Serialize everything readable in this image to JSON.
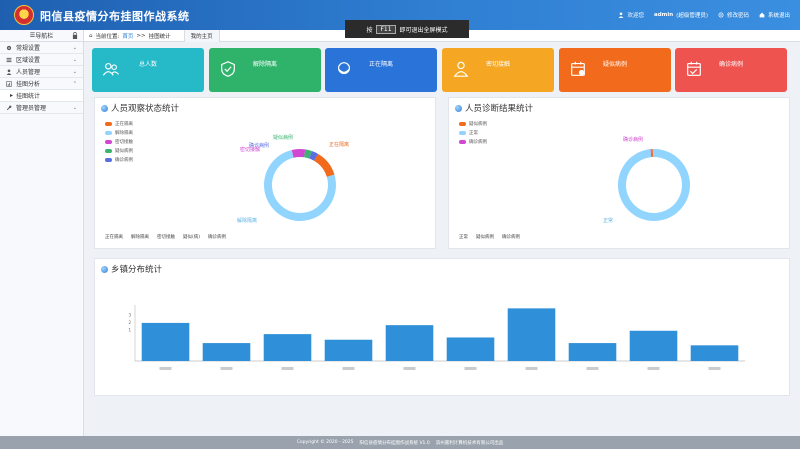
{
  "header": {
    "title": "阳信县疫情分布挂图作战系统",
    "welcome": "欢迎您",
    "user": "admin",
    "role": "(超级管理员)",
    "change_password": "修改密码",
    "logout": "系统退出"
  },
  "fullscreen_tip": {
    "prefix": "按",
    "key": "F11",
    "suffix": "即可退出全屏模式"
  },
  "sidebar": {
    "header": "导航栏",
    "items": [
      {
        "label": "常规设置",
        "icon": "gear-icon"
      },
      {
        "label": "区域设置",
        "icon": "list-icon"
      },
      {
        "label": "人员管理",
        "icon": "user-icon"
      },
      {
        "label": "挂图分析",
        "icon": "chart-icon"
      },
      {
        "label": "挂图统计",
        "icon": "sub-icon"
      },
      {
        "label": "管理员管理",
        "icon": "wrench-icon"
      }
    ]
  },
  "breadcrumb": {
    "prefix": "当前位置:",
    "home": "首页",
    "sep": ">>",
    "current": "挂图统计",
    "tab": "我的主页"
  },
  "cards": [
    {
      "label": "总人数",
      "value": "",
      "color": "#26b9c7",
      "icon": "people-icon"
    },
    {
      "label": "解除隔离",
      "value": "",
      "color": "#2fb36b",
      "icon": "shield-check-icon"
    },
    {
      "label": "正在隔离",
      "value": "",
      "color": "#2a73d8",
      "icon": "mask-icon"
    },
    {
      "label": "密切接触",
      "value": "",
      "color": "#f5a623",
      "icon": "person-icon"
    },
    {
      "label": "疑似病例",
      "value": "",
      "color": "#f26a1b",
      "icon": "calendar-icon"
    },
    {
      "label": "确诊病例",
      "value": "",
      "color": "#ef5350",
      "icon": "calendar-check-icon"
    }
  ],
  "observe_panel": {
    "title": "人员观察状态统计",
    "legend": [
      {
        "label": "正在隔离",
        "color": "#f26a1b"
      },
      {
        "label": "解除隔离",
        "color": "#91d5ff"
      },
      {
        "label": "密切接触",
        "color": "#d147d1"
      },
      {
        "label": "疑似病例",
        "color": "#3cb371"
      },
      {
        "label": "确诊病例",
        "color": "#5b6ee1"
      }
    ],
    "donut_labels": [
      "疑似病例",
      "确诊病例",
      "密切接触",
      "正在隔离",
      "解除隔离"
    ],
    "bottom": [
      "正在隔离",
      "解除隔离",
      "密切接触",
      "疑似(病)",
      "确诊病例"
    ]
  },
  "diagnose_panel": {
    "title": "人员诊断结果统计",
    "legend": [
      {
        "label": "疑似病例",
        "color": "#f26a1b"
      },
      {
        "label": "正常",
        "color": "#91d5ff"
      },
      {
        "label": "确诊病例",
        "color": "#d147d1"
      }
    ],
    "donut_labels": [
      "确诊病例",
      "正常"
    ],
    "bottom": [
      "正常",
      "疑似病例",
      "确诊病例"
    ]
  },
  "town_panel": {
    "title": "乡镇分布统计"
  },
  "chart_data": [
    {
      "type": "pie",
      "title": "人员观察状态统计",
      "labels": [
        "正在隔离",
        "解除隔离",
        "密切接触",
        "疑似病例",
        "确诊病例"
      ],
      "values": [
        12,
        76,
        6,
        3,
        3
      ],
      "colors": [
        "#f26a1b",
        "#91d5ff",
        "#d147d1",
        "#3cb371",
        "#5b6ee1"
      ]
    },
    {
      "type": "pie",
      "title": "人员诊断结果统计",
      "labels": [
        "正常",
        "确诊病例",
        "疑似病例"
      ],
      "values": [
        99,
        0.5,
        0.5
      ],
      "colors": [
        "#91d5ff",
        "#d147d1",
        "#f26a1b"
      ]
    },
    {
      "type": "bar",
      "title": "乡镇分布统计",
      "categories": [
        "",
        "",
        "",
        "",
        "",
        "",
        "",
        "",
        "",
        "",
        ""
      ],
      "values": [
        3.4,
        1.6,
        2.4,
        1.9,
        3.2,
        2.1,
        4.7,
        1.6,
        2.7,
        1.4,
        0
      ],
      "ylim": [
        0,
        5
      ],
      "yticks": [
        "",
        "1",
        "2",
        "3"
      ],
      "color": "#2f8fd8"
    }
  ],
  "footer": {
    "copyright": "Copyright © 2020 - 2025",
    "system": "阳信县疫情分布挂图作战系统 V1.0",
    "company": "滨州嘉利计算机技术有限公司出品"
  }
}
